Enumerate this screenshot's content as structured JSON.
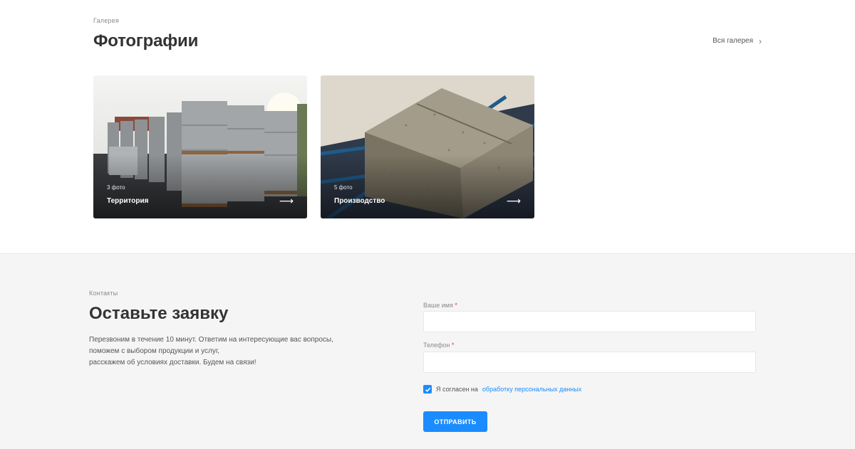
{
  "gallery": {
    "eyebrow": "Галерея",
    "title": "Фотографии",
    "all_link": "Вся галерея",
    "cards": [
      {
        "count": "3 фото",
        "title": "Территория"
      },
      {
        "count": "5 фото",
        "title": "Производство"
      }
    ]
  },
  "contact": {
    "eyebrow": "Контакты",
    "title": "Оставьте заявку",
    "description_lines": [
      "Перезвоним в течение 10 минут. Ответим на интересующие вас вопросы,",
      "поможем с выбором продукции и услуг,",
      "расскажем об условиях доставки. Будем на связи!"
    ],
    "name_label": "Ваше имя",
    "phone_label": "Телефон",
    "required_mark": "*",
    "name_value": "",
    "phone_value": "",
    "consent_text": "Я согласен на",
    "consent_link": "обработку персональных данных",
    "consent_checked": true,
    "submit_label": "ОТПРАВИТЬ"
  },
  "colors": {
    "accent": "#1a8cff",
    "required": "#e53935",
    "section_bg": "#f5f5f5"
  },
  "icons": {
    "all_link": "chevron-right-icon",
    "card_arrow": "arrow-right-icon",
    "checkbox": "check-icon"
  }
}
